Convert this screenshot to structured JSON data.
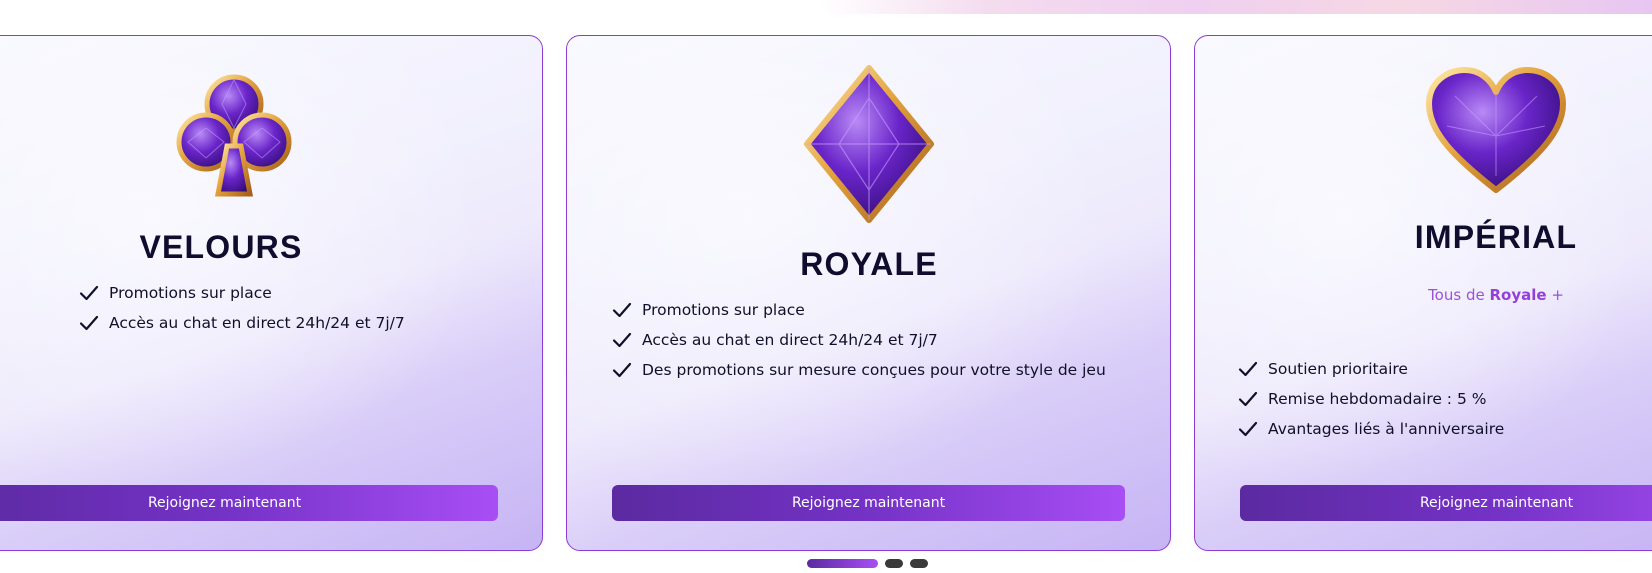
{
  "cards": [
    {
      "icon": "club-gem-icon",
      "title": "VELOURS",
      "features": [
        "Promotions sur place",
        "Accès au chat en direct 24h/24 et 7j/7"
      ],
      "button_label": "Rejoignez maintenant"
    },
    {
      "icon": "diamond-gem-icon",
      "title": "ROYALE",
      "features": [
        "Promotions sur place",
        "Accès au chat en direct 24h/24 et 7j/7",
        "Des promotions sur mesure conçues pour votre style de jeu"
      ],
      "button_label": "Rejoignez maintenant"
    },
    {
      "icon": "heart-gem-icon",
      "title": "IMPÉRIAL",
      "subtitle_prefix": "Tous de",
      "subtitle_bold": "Royale",
      "subtitle_suffix": "+",
      "features": [
        "Soutien prioritaire",
        "Remise hebdomadaire : 5 %",
        "Avantages liés à l'anniversaire"
      ],
      "button_label": "Rejoignez maintenant"
    }
  ],
  "pagination": {
    "total": 3,
    "active": 1
  },
  "colors": {
    "accent": "#8d3bd6",
    "button_start": "#5b2aa0",
    "button_end": "#a84ef5",
    "subtitle": "#9b52d8"
  }
}
